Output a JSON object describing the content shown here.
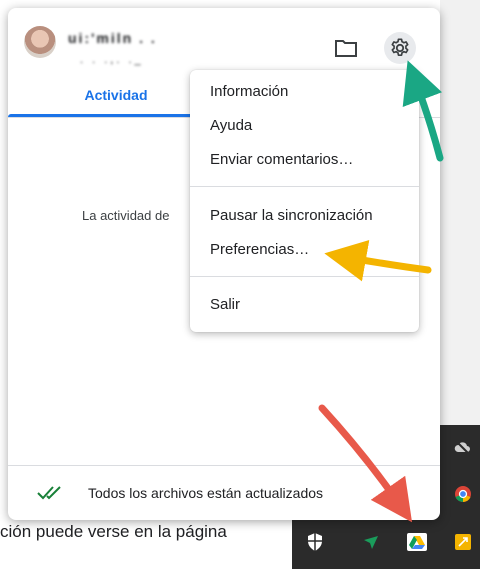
{
  "account": {
    "name": "ui:'miln . .",
    "email": ". . .,. ._"
  },
  "tabs": [
    {
      "label": "Actividad"
    }
  ],
  "activity": {
    "message": "La actividad de"
  },
  "menu": {
    "items": [
      {
        "label": "Información"
      },
      {
        "label": "Ayuda"
      },
      {
        "label": "Enviar comentarios…"
      },
      {
        "label": "Pausar la sincronización"
      },
      {
        "label": "Preferencias…"
      },
      {
        "label": "Salir"
      }
    ]
  },
  "footer": {
    "status": "Todos los archivos están actualizados"
  },
  "background": {
    "page_text": "ción puede verse en la página"
  },
  "colors": {
    "accent": "#1a73e8",
    "arrow_green": "#1aa784",
    "arrow_yellow": "#f4b400",
    "arrow_red": "#e8594a",
    "check_green": "#188038"
  },
  "icons": {
    "folder": "folder-icon",
    "settings": "gear-icon",
    "status": "double-check-icon",
    "tray": [
      "cloud-off-icon",
      "chrome-icon",
      "shield-icon",
      "bird-icon",
      "google-drive-icon",
      "app-tile-icon"
    ]
  }
}
